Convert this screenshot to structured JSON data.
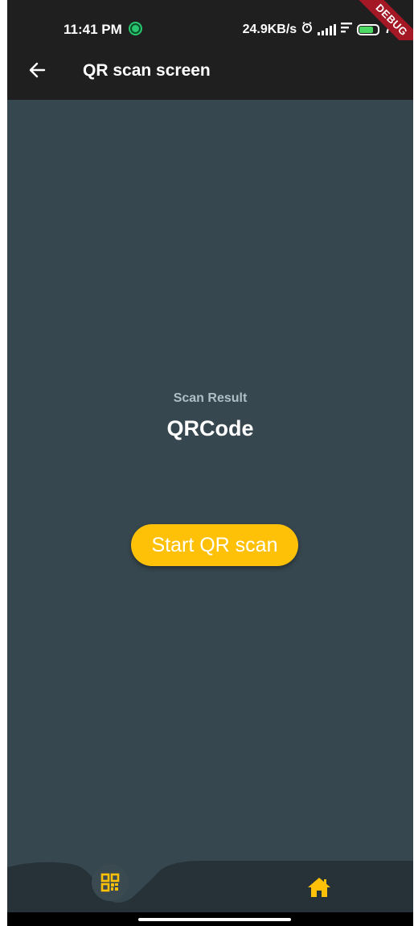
{
  "status_bar": {
    "time": "11:41 PM",
    "network_speed": "24.9KB/s",
    "battery_level": "76",
    "icons": [
      "app-notification-icon",
      "alarm-icon",
      "signal-icon",
      "wifi-icon",
      "battery-icon"
    ]
  },
  "debug_banner": "DEBUG",
  "app_bar": {
    "title": "QR scan screen",
    "back_icon": "arrow-back-icon"
  },
  "main": {
    "scan_label": "Scan Result",
    "scan_value": "QRCode",
    "start_button_label": "Start QR scan"
  },
  "bottom_nav": {
    "items": [
      {
        "icon": "qr-code-icon",
        "active": true
      },
      {
        "icon": "home-icon",
        "active": false
      }
    ]
  },
  "colors": {
    "app_bar": "#1f1f1f",
    "background": "#37474f",
    "accent": "#ffc107",
    "label": "#b0bec5"
  }
}
